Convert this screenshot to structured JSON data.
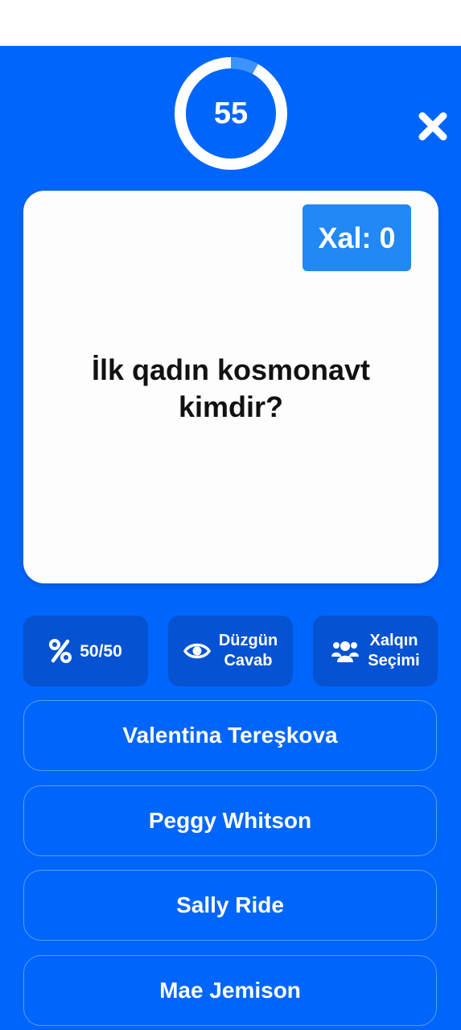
{
  "timer": {
    "value": "55",
    "progress": 0.92
  },
  "close": {
    "icon": "close-icon"
  },
  "question": {
    "score_label": "Xal: 0",
    "text_line1": "İlk qadın kosmonavt",
    "text_line2": "kimdir?"
  },
  "lifelines": {
    "fifty": {
      "label": "50/50",
      "icon": "percent-icon"
    },
    "correct": {
      "label_line1": "Düzgün",
      "label_line2": "Cavab",
      "icon": "eye-icon"
    },
    "audience": {
      "label_line1": "Xalqın",
      "label_line2": "Seçimi",
      "icon": "users-icon"
    }
  },
  "answers": [
    {
      "label": "Valentina Tereşkova"
    },
    {
      "label": "Peggy Whitson"
    },
    {
      "label": "Sally Ride"
    },
    {
      "label": "Mae Jemison"
    }
  ],
  "colors": {
    "background": "#0066fb",
    "ring_track": "#ffffff",
    "ring_progress": "#3d93ff",
    "card": "#fdfdfd",
    "score_badge": "#2288f4",
    "lifeline_bg": "#0552d3"
  }
}
